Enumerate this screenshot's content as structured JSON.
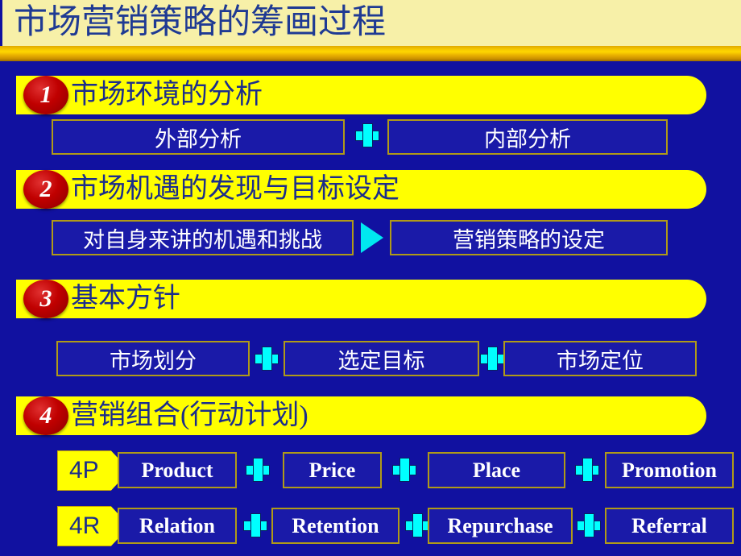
{
  "slide": {
    "title": "市场营销策略的筹画过程",
    "background_color": "#1111A0",
    "title_band_color": "#F7F0A8",
    "title_text_color": "#1F3A93",
    "accent_bar_color": "#FFD700",
    "header_bar_color": "#FFFF00",
    "badge_color": "#C00000",
    "connector_color": "#00FFFF",
    "box_border_color": "#B09A18"
  },
  "sections": [
    {
      "number": "1",
      "heading": "市场环境的分析",
      "items": [
        {
          "label": "外部分析"
        },
        {
          "label": "内部分析"
        }
      ],
      "connector": "plus-icon"
    },
    {
      "number": "2",
      "heading": "市场机遇的发现与目标设定",
      "items": [
        {
          "label": "对自身来讲的机遇和挑战"
        },
        {
          "label": "营销策略的设定"
        }
      ],
      "connector": "triangle-right-icon"
    },
    {
      "number": "3",
      "heading": "基本方针",
      "items": [
        {
          "label": "市场划分"
        },
        {
          "label": "选定目标"
        },
        {
          "label": "市场定位"
        }
      ],
      "connector": "plus-icon"
    },
    {
      "number": "4",
      "heading": "营销组合(行动计划)",
      "rows": [
        {
          "tag": "4P",
          "items": [
            {
              "label": "Product"
            },
            {
              "label": "Price"
            },
            {
              "label": "Place"
            },
            {
              "label": "Promotion"
            }
          ]
        },
        {
          "tag": "4R",
          "items": [
            {
              "label": "Relation"
            },
            {
              "label": "Retention"
            },
            {
              "label": "Repurchase"
            },
            {
              "label": "Referral"
            }
          ]
        }
      ],
      "connector": "plus-icon"
    }
  ]
}
